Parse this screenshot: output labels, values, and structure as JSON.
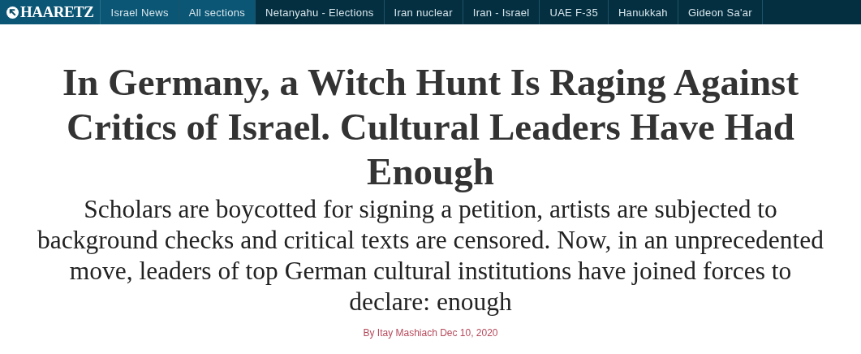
{
  "logo": "HAARETZ",
  "nav": [
    {
      "label": "Israel News",
      "kind": "section"
    },
    {
      "label": "All sections",
      "kind": "section"
    },
    {
      "label": "Netanyahu - Elections",
      "kind": "topic"
    },
    {
      "label": "Iran nuclear",
      "kind": "topic"
    },
    {
      "label": "Iran - Israel",
      "kind": "topic"
    },
    {
      "label": "UAE F-35",
      "kind": "topic"
    },
    {
      "label": "Hanukkah",
      "kind": "topic"
    },
    {
      "label": "Gideon Sa'ar",
      "kind": "topic"
    }
  ],
  "article": {
    "headline": "In Germany, a Witch Hunt Is Raging Against Critics of Israel. Cultural Leaders Have Had Enough",
    "subheadline": "Scholars are boycotted for signing a petition, artists are subjected to background checks and critical texts are censored. Now, in an unprecedented move, leaders of top German cultural institutions have joined forces to declare: enough",
    "byline": "By Itay Mashiach Dec 10, 2020"
  }
}
